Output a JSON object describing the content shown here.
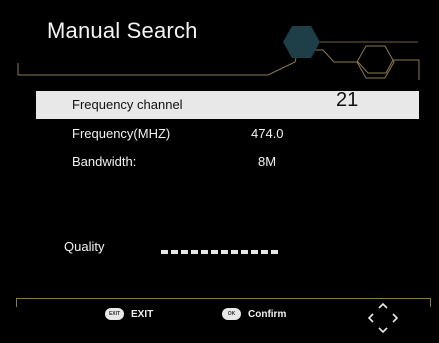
{
  "header": {
    "title": "Manual Search"
  },
  "rows": [
    {
      "label": "Frequency channel",
      "value": "21"
    },
    {
      "label": "Frequency(MHZ)",
      "value": "474.0"
    },
    {
      "label": "Bandwidth:",
      "value": "8M"
    }
  ],
  "quality": {
    "label": "Quality"
  },
  "footer": {
    "exit_key": "EXIT",
    "exit_label": "EXIT",
    "ok_key": "OK",
    "confirm_label": "Confirm"
  },
  "colors": {
    "accent_line": "#8a7a4a",
    "hex_fill": "#1f3f48",
    "selected_row": "#e8e8e8"
  }
}
